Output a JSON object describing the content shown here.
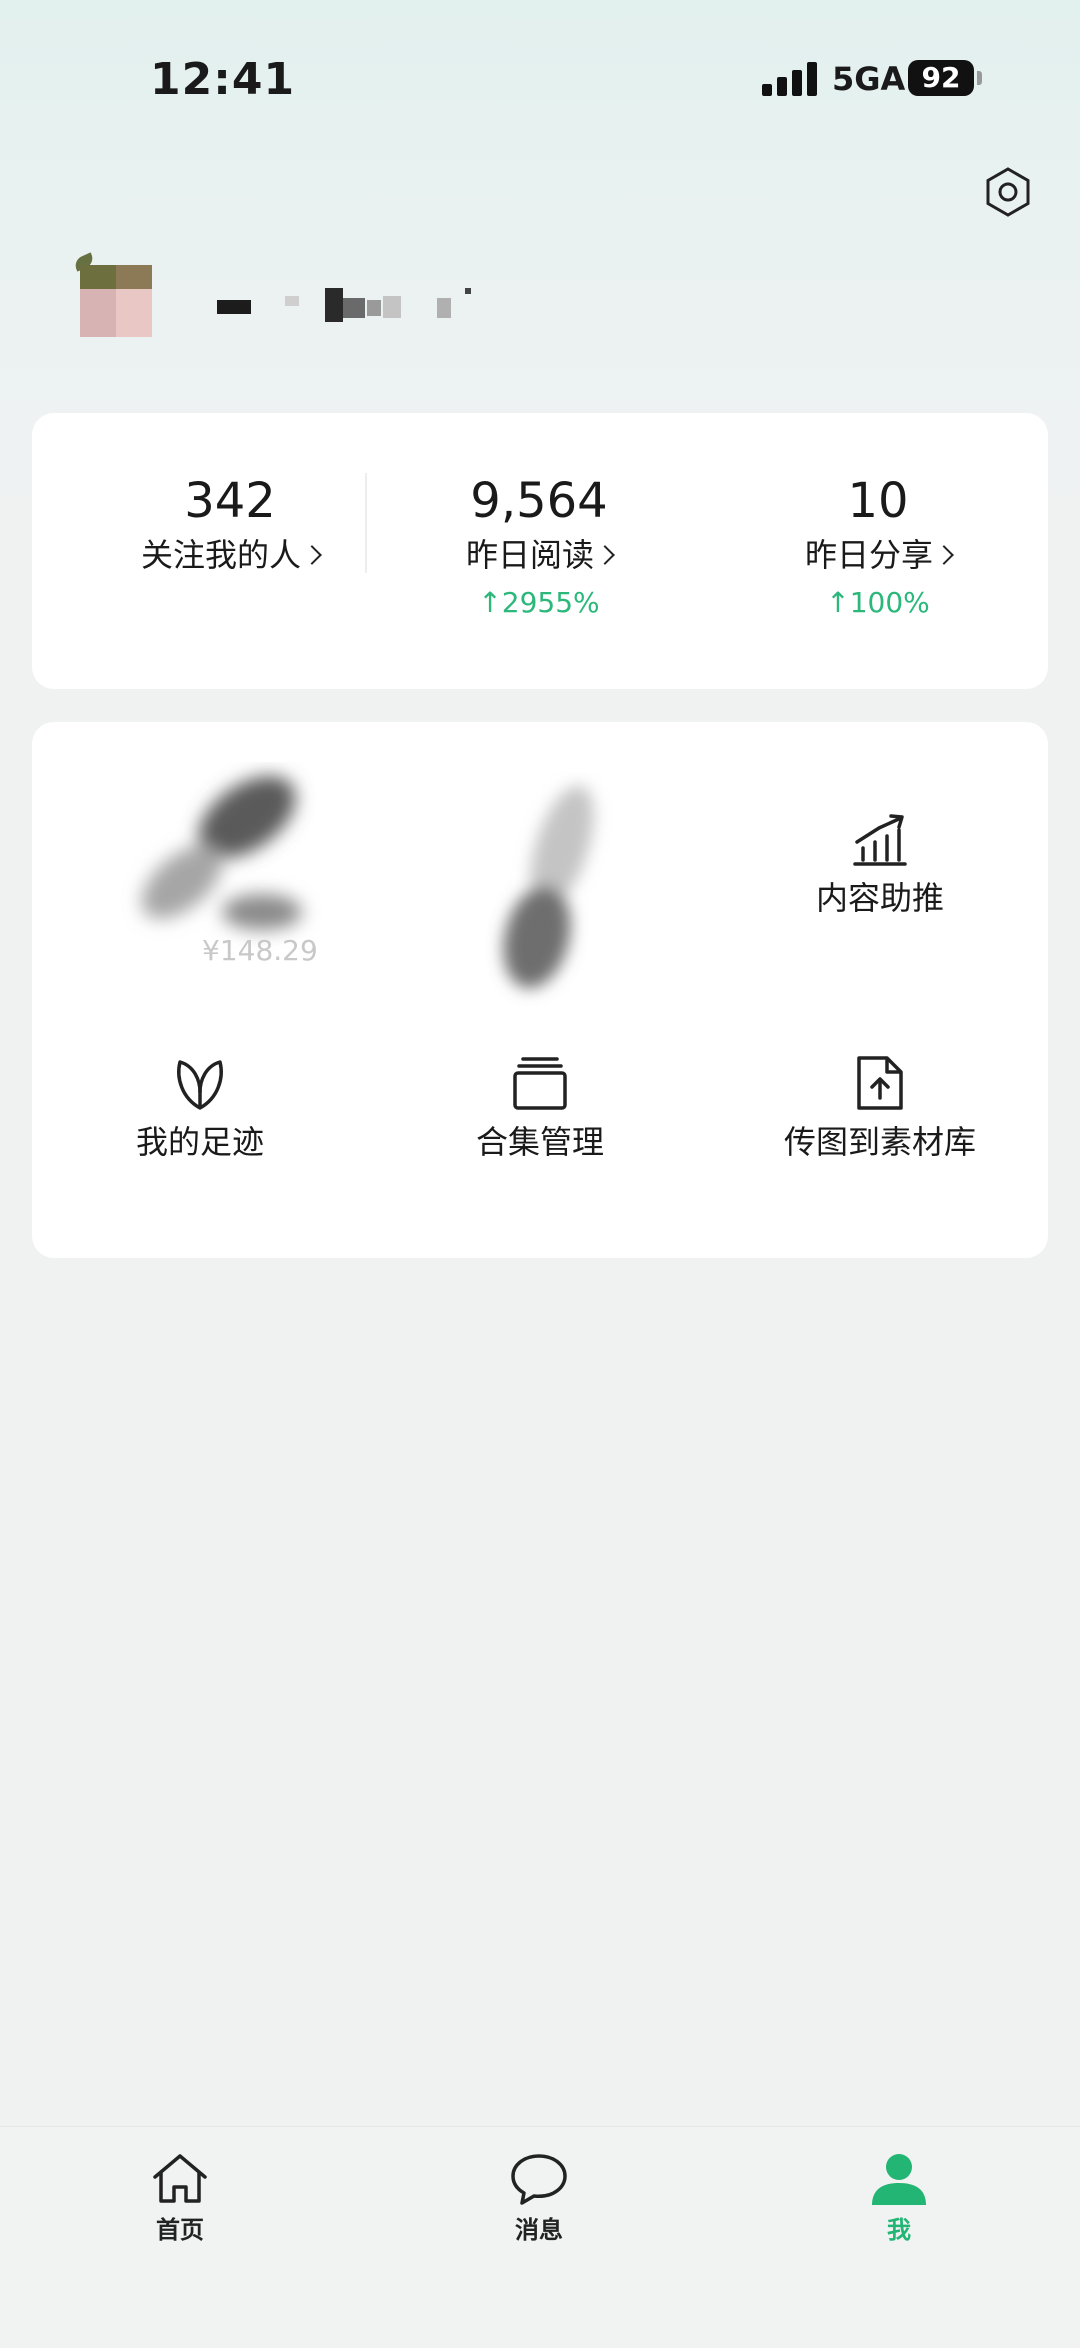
{
  "status_bar": {
    "time": "12:41",
    "network": "5GA",
    "battery": "92"
  },
  "header": {
    "settings_icon": "settings-hexagon-icon"
  },
  "profile": {
    "username": "",
    "avatar": "pixelated-avatar"
  },
  "stats": [
    {
      "value": "342",
      "label": "关注我的人",
      "change": ""
    },
    {
      "value": "9,564",
      "label": "昨日阅读",
      "change": "↑2955%"
    },
    {
      "value": "10",
      "label": "昨日分享",
      "change": "↑100%"
    }
  ],
  "tools": {
    "blurred_amount": "¥148.29",
    "content_promote": {
      "label": "内容助推",
      "icon": "growth-chart-icon"
    },
    "my_footprints": {
      "label": "我的足迹",
      "icon": "sprout-icon"
    },
    "collection_manage": {
      "label": "合集管理",
      "icon": "stack-folder-icon"
    },
    "upload_images": {
      "label": "传图到素材库",
      "icon": "file-upload-icon"
    }
  },
  "tab_bar": {
    "active_color": "#22b573",
    "items": [
      {
        "label": "首页",
        "icon": "home-icon"
      },
      {
        "label": "消息",
        "icon": "chat-bubble-icon"
      },
      {
        "label": "我",
        "icon": "person-icon"
      }
    ]
  }
}
